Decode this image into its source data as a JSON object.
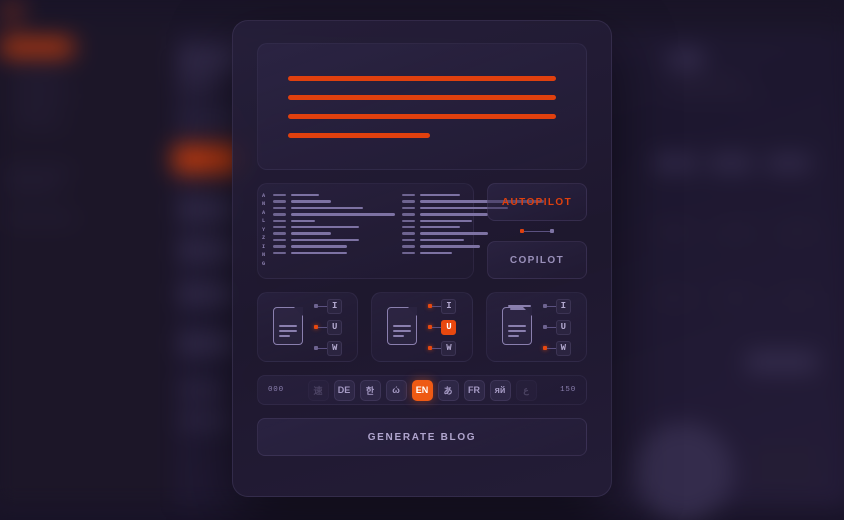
{
  "theme": {
    "accent": "#e0400e",
    "accent_bright": "#ee5a14",
    "bg": "#181327",
    "panel": "#261f3a",
    "text_muted": "#a59ac4"
  },
  "background_app": {
    "logo": "circle-logo",
    "note": "blurred out-of-focus application behind the modal"
  },
  "modal": {
    "hero": {
      "bars": [
        100,
        100,
        100,
        53
      ]
    },
    "analyzer": {
      "status_label": "ANALYZING",
      "status_letters": [
        "A",
        "N",
        "A",
        "L",
        "Y",
        "Z",
        "I",
        "N",
        "G"
      ],
      "columns": [
        {
          "lines": [
            28,
            40,
            72,
            104,
            24,
            68,
            40,
            68,
            56,
            56
          ]
        },
        {
          "lines": [
            40,
            124,
            88,
            68,
            52,
            40,
            68,
            44,
            60,
            32
          ]
        }
      ]
    },
    "pilot": {
      "autopilot_label": "AUTOPILOT",
      "copilot_label": "COPILOT",
      "selected": "AUTOPILOT"
    },
    "doc_cards": [
      {
        "icon": "document-icon",
        "options": [
          {
            "key": "I",
            "dot_active": false,
            "key_active": false
          },
          {
            "key": "U",
            "dot_active": true,
            "key_active": false
          },
          {
            "key": "W",
            "dot_active": false,
            "key_active": false
          }
        ]
      },
      {
        "icon": "document-icon",
        "options": [
          {
            "key": "I",
            "dot_active": true,
            "key_active": false
          },
          {
            "key": "U",
            "dot_active": true,
            "key_active": true
          },
          {
            "key": "W",
            "dot_active": true,
            "key_active": false
          }
        ]
      },
      {
        "icon": "document-stack-icon",
        "options": [
          {
            "key": "I",
            "dot_active": false,
            "key_active": false
          },
          {
            "key": "U",
            "dot_active": false,
            "key_active": false
          },
          {
            "key": "W",
            "dot_active": true,
            "key_active": false
          }
        ]
      }
    ],
    "language_bar": {
      "left_count": "000",
      "right_count": "150",
      "chips": [
        {
          "label": "速",
          "state": "dim"
        },
        {
          "label": "DE",
          "state": "normal"
        },
        {
          "label": "한",
          "state": "normal"
        },
        {
          "label": "ώ",
          "state": "normal"
        },
        {
          "label": "EN",
          "state": "active"
        },
        {
          "label": "あ",
          "state": "normal"
        },
        {
          "label": "FR",
          "state": "normal"
        },
        {
          "label": "яй",
          "state": "normal"
        },
        {
          "label": "ع",
          "state": "dim"
        }
      ]
    },
    "generate_button": {
      "label": "GENERATE BLOG"
    }
  }
}
